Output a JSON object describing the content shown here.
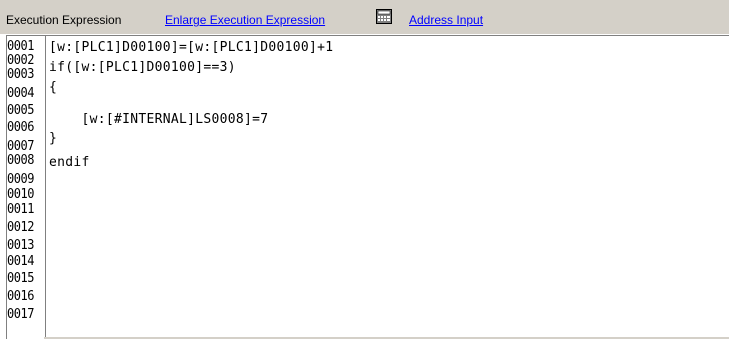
{
  "toolbar": {
    "label": "Execution Expression",
    "enlarge_link": "Enlarge Execution Expression",
    "address_link": "Address Input",
    "calculator_icon": "calculator-icon"
  },
  "editor": {
    "line_numbers": [
      "0001",
      "0002",
      "0003",
      "0004",
      "0005",
      "0006",
      "0007",
      "0008",
      "0009",
      "0010",
      "0011",
      "0012",
      "0013",
      "0014",
      "0015",
      "0016",
      "0017"
    ],
    "code_lines": [
      "[w:[PLC1]D00100]=[w:[PLC1]D00100]+1",
      "if([w:[PLC1]D00100]==3)",
      "{",
      "    [w:[#INTERNAL]LS0008]=7",
      "}",
      "endif"
    ]
  },
  "colors": {
    "toolbar_bg": "#d4d0c8",
    "link": "#0000ff",
    "text": "#000000"
  }
}
